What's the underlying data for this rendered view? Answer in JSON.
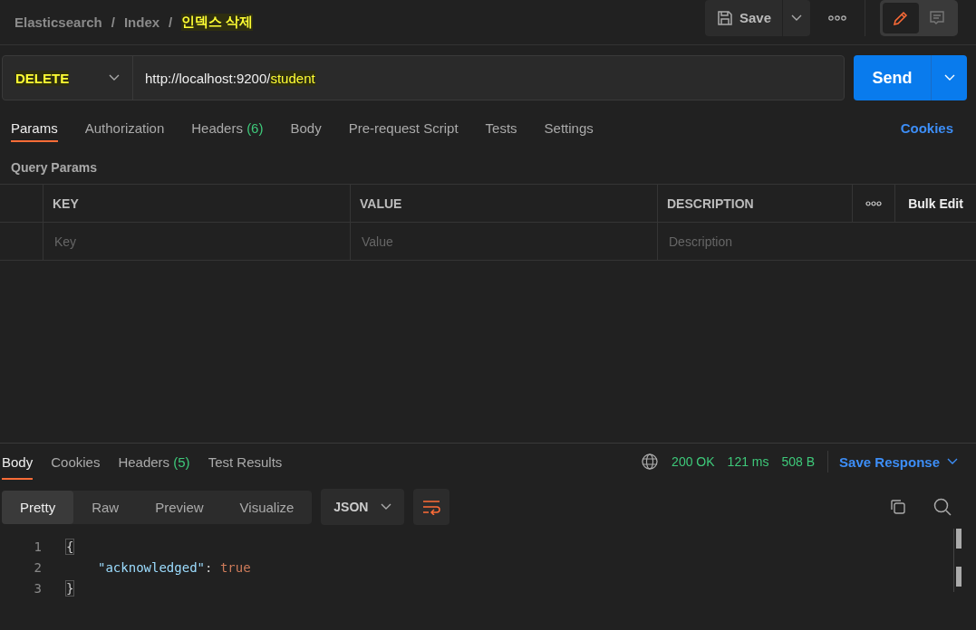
{
  "breadcrumb": [
    {
      "text": "Elasticsearch",
      "highlighted": false
    },
    {
      "separator": "/",
      "text": "Index",
      "highlighted": false
    },
    {
      "separator": "/",
      "text": "인덱스 삭제",
      "highlighted": true
    }
  ],
  "toolbar": {
    "save_label": "Save",
    "modes": [
      {
        "kind": "edit",
        "selected": true
      },
      {
        "kind": "comment",
        "selected": false
      }
    ]
  },
  "request": {
    "method": "DELETE",
    "method_highlighted": true,
    "url_parts": [
      {
        "text": "http://localhost:9200/",
        "highlighted": false
      },
      {
        "text": "student",
        "highlighted": true
      }
    ],
    "send_label": "Send"
  },
  "request_tabs": [
    {
      "label": "Params",
      "selected": true
    },
    {
      "label": "Authorization",
      "selected": false
    },
    {
      "label": "Headers",
      "count": "(6)",
      "selected": false
    },
    {
      "label": "Body",
      "selected": false
    },
    {
      "label": "Pre-request Script",
      "selected": false
    },
    {
      "label": "Tests",
      "selected": false
    },
    {
      "label": "Settings",
      "selected": false
    }
  ],
  "cookies_link": "Cookies",
  "query_params": {
    "title": "Query Params",
    "columns": [
      "KEY",
      "VALUE",
      "DESCRIPTION"
    ],
    "bulk_edit": "Bulk Edit",
    "placeholders": [
      "Key",
      "Value",
      "Description"
    ]
  },
  "response_tabs": [
    {
      "label": "Body",
      "selected": true
    },
    {
      "label": "Cookies",
      "selected": false
    },
    {
      "label": "Headers",
      "count": "(5)",
      "selected": false
    },
    {
      "label": "Test Results",
      "selected": false
    }
  ],
  "status": {
    "code": "200 OK",
    "time": "121 ms",
    "size": "508 B",
    "save_response": "Save Response"
  },
  "view_modes": [
    {
      "label": "Pretty",
      "selected": true
    },
    {
      "label": "Raw",
      "selected": false
    },
    {
      "label": "Preview",
      "selected": false
    },
    {
      "label": "Visualize",
      "selected": false
    }
  ],
  "format": "JSON",
  "code_lines": [
    {
      "number": "1",
      "kind": "brace",
      "text": "{"
    },
    {
      "number": "2",
      "kind": "pair",
      "key": "\"acknowledged\"",
      "sep": ": ",
      "value": "true"
    },
    {
      "number": "3",
      "kind": "brace",
      "text": "}"
    }
  ]
}
